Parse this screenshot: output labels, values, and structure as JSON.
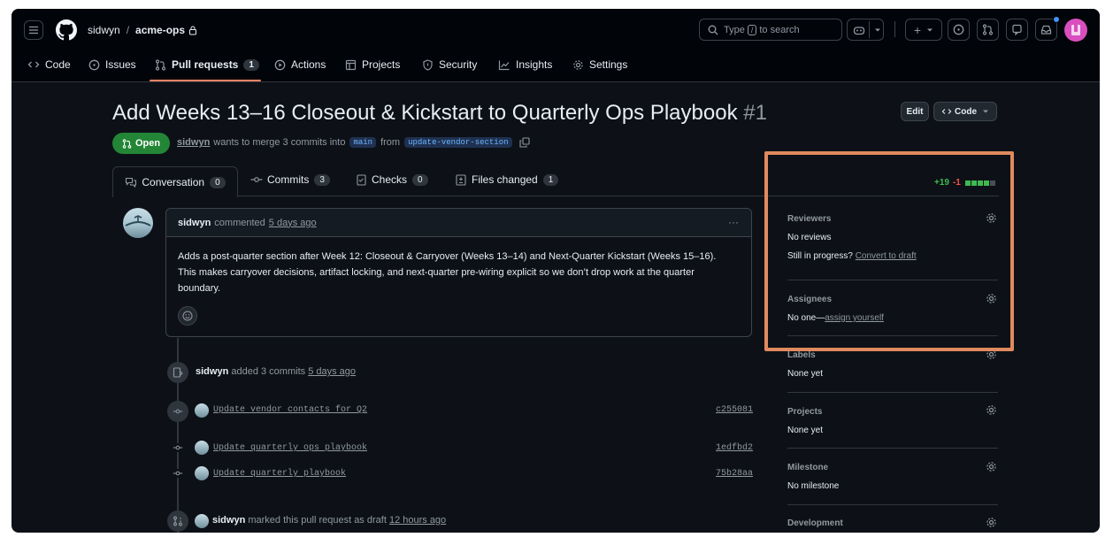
{
  "header": {
    "owner": "sidwyn",
    "separator": "/",
    "repo": "acme-ops",
    "search_placeholder_pre": "Type",
    "search_key": "/",
    "search_placeholder_post": "to search",
    "plus_label": "+",
    "nav": [
      {
        "label": "Code",
        "icon": "code-icon"
      },
      {
        "label": "Issues",
        "icon": "issue-icon"
      },
      {
        "label": "Pull requests",
        "icon": "pull-request-icon",
        "count": "1"
      },
      {
        "label": "Actions",
        "icon": "play-icon"
      },
      {
        "label": "Projects",
        "icon": "table-icon"
      },
      {
        "label": "Security",
        "icon": "shield-icon"
      },
      {
        "label": "Insights",
        "icon": "graph-icon"
      },
      {
        "label": "Settings",
        "icon": "gear-icon"
      }
    ]
  },
  "pr": {
    "title": "Add Weeks 13–16 Closeout & Kickstart to Quarterly Ops Playbook",
    "number": "#1",
    "edit_label": "Edit",
    "code_label": "Code",
    "state": "Open",
    "author": "sidwyn",
    "meta_mid": "wants to merge 3 commits into",
    "base_branch": "main",
    "from_word": "from",
    "head_branch": "update-vendor-section"
  },
  "tabs": [
    {
      "label": "Conversation",
      "count": "0"
    },
    {
      "label": "Commits",
      "count": "3"
    },
    {
      "label": "Checks",
      "count": "0"
    },
    {
      "label": "Files changed",
      "count": "1"
    }
  ],
  "diffstat": {
    "additions": "+19",
    "deletions": "-1"
  },
  "comment": {
    "author": "sidwyn",
    "action": "commented",
    "time": "5 days ago",
    "menu": "···",
    "body": "Adds a post-quarter section after Week 12: Closeout & Carryover (Weeks 13–14) and Next-Quarter Kickstart (Weeks 15–16). This makes carryover decisions, artifact locking, and next-quarter pre-wiring explicit so we don’t drop work at the quarter boundary."
  },
  "timeline": {
    "added": {
      "author": "sidwyn",
      "text": "added 3 commits",
      "time": "5 days ago"
    },
    "commits": [
      {
        "message": "Update vendor contacts for Q2",
        "sha": "c255081"
      },
      {
        "message": "Update quarterly ops playbook",
        "sha": "1edfbd2"
      },
      {
        "message": "Update quarterly playbook",
        "sha": "75b28aa"
      }
    ],
    "draft": {
      "author": "sidwyn",
      "text": "marked this pull request as draft",
      "time": "12 hours ago"
    }
  },
  "sidebar": {
    "reviewers": {
      "heading": "Reviewers",
      "value": "No reviews",
      "hint_pre": "Still in progress?",
      "hint_link": "Convert to draft"
    },
    "assignees": {
      "heading": "Assignees",
      "value_pre": "No one—",
      "value_link": "assign yourself"
    },
    "labels": {
      "heading": "Labels",
      "value": "None yet"
    },
    "projects": {
      "heading": "Projects",
      "value": "None yet"
    },
    "milestone": {
      "heading": "Milestone",
      "value": "No milestone"
    },
    "development": {
      "heading": "Development"
    }
  },
  "colors": {
    "highlight_box": "#e08a5f",
    "open_badge": "#238636",
    "additions": "#3fb950",
    "deletions": "#f85149",
    "link": "#4493f8"
  }
}
